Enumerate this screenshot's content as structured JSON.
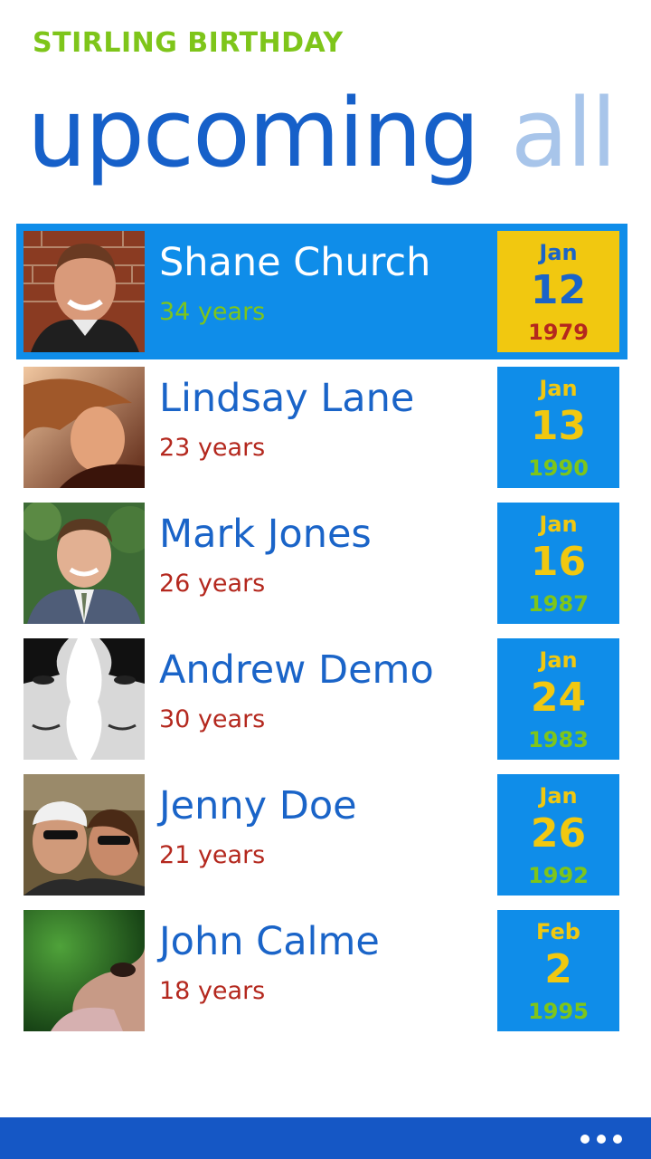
{
  "app": {
    "title": "STIRLING BIRTHDAY"
  },
  "pivot": {
    "tabs": [
      {
        "label": "upcoming",
        "active": true
      },
      {
        "label": "all p",
        "active": false
      }
    ]
  },
  "colors": {
    "accent_blue": "#0f8de9",
    "title_green": "#7ec51a",
    "name_blue": "#1a64c8",
    "age_red": "#b4281e",
    "date_yellow": "#f1c810",
    "appbar_blue": "#1557c5"
  },
  "birthdays": [
    {
      "name": "Shane Church",
      "age": "34 years",
      "month": "Jan",
      "day": "12",
      "year": "1979",
      "selected": true,
      "avatar": "portrait-brick-wall"
    },
    {
      "name": "Lindsay Lane",
      "age": "23 years",
      "month": "Jan",
      "day": "13",
      "year": "1990",
      "selected": false,
      "avatar": "portrait-profile-warm"
    },
    {
      "name": "Mark Jones",
      "age": "26 years",
      "month": "Jan",
      "day": "16",
      "year": "1987",
      "selected": false,
      "avatar": "portrait-suit-outdoors"
    },
    {
      "name": "Andrew Demo",
      "age": "30 years",
      "month": "Jan",
      "day": "24",
      "year": "1983",
      "selected": false,
      "avatar": "portrait-mirrored-faces"
    },
    {
      "name": "Jenny Doe",
      "age": "21 years",
      "month": "Jan",
      "day": "26",
      "year": "1992",
      "selected": false,
      "avatar": "portrait-two-friends"
    },
    {
      "name": "John Calme",
      "age": "18 years",
      "month": "Feb",
      "day": "2",
      "year": "1995",
      "selected": false,
      "avatar": "portrait-green-closeup"
    }
  ],
  "appbar": {
    "more_icon": "ellipsis-icon"
  }
}
